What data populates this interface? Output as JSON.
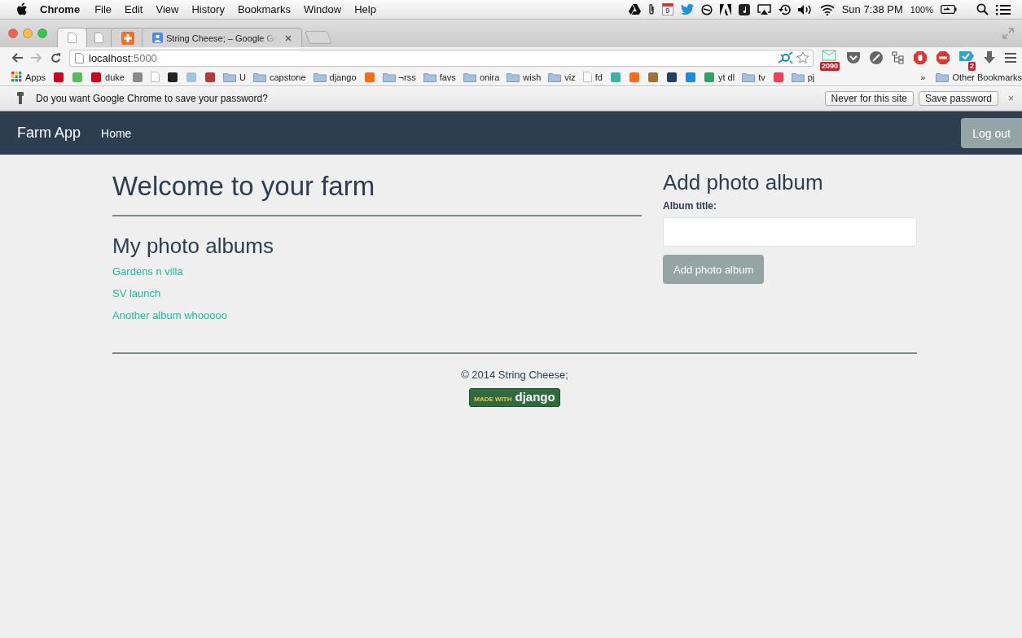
{
  "menubar": {
    "app": "Chrome",
    "menus": [
      "File",
      "Edit",
      "View",
      "History",
      "Bookmarks",
      "Window",
      "Help"
    ],
    "calendar_day": "9",
    "clock": "Sun 7:38 PM",
    "battery": "100%"
  },
  "tabs": [
    {
      "kind": "blank",
      "selected": true
    },
    {
      "kind": "blank",
      "selected": false
    },
    {
      "kind": "plus",
      "selected": false
    },
    {
      "kind": "site",
      "title": "String Cheese; – Google Gr",
      "selected": false
    }
  ],
  "toolbar": {
    "host": "localhost",
    "port": ":5000",
    "mail_badge": "2090",
    "task_badge": "2"
  },
  "bookmarks": [
    {
      "kind": "apps",
      "label": "Apps"
    },
    {
      "kind": "site",
      "color": "#d0021b"
    },
    {
      "kind": "site",
      "color": "#5cb85c"
    },
    {
      "kind": "site",
      "color": "#d0021b",
      "label": "duke"
    },
    {
      "kind": "site",
      "color": "#8a8a8a"
    },
    {
      "kind": "page"
    },
    {
      "kind": "site",
      "color": "#222222"
    },
    {
      "kind": "site",
      "color": "#9ec4e0"
    },
    {
      "kind": "site",
      "color": "#b23a3a"
    },
    {
      "kind": "folder",
      "label": "U"
    },
    {
      "kind": "folder",
      "label": "capstone"
    },
    {
      "kind": "folder",
      "label": "django"
    },
    {
      "kind": "site",
      "color": "#ff6a13"
    },
    {
      "kind": "folder",
      "label": "¬rss"
    },
    {
      "kind": "folder",
      "label": "favs"
    },
    {
      "kind": "folder",
      "label": "onira"
    },
    {
      "kind": "folder",
      "label": "wish"
    },
    {
      "kind": "folder",
      "label": "viz"
    },
    {
      "kind": "page",
      "label": "fd"
    },
    {
      "kind": "site",
      "color": "#3bb3a0"
    },
    {
      "kind": "site",
      "color": "#ff6a13"
    },
    {
      "kind": "site",
      "color": "#a0703a"
    },
    {
      "kind": "site",
      "color": "#1f3f6a"
    },
    {
      "kind": "site",
      "color": "#1e88e5"
    },
    {
      "kind": "site",
      "color": "#2fa06a",
      "label": "yt dl"
    },
    {
      "kind": "folder",
      "label": "tv"
    },
    {
      "kind": "site",
      "color": "#ee4056"
    },
    {
      "kind": "folder",
      "label": "pj"
    },
    {
      "kind": "overflow",
      "label": "»"
    },
    {
      "kind": "folder",
      "label": "Other Bookmarks"
    }
  ],
  "infobar": {
    "message": "Do you want Google Chrome to save your password?",
    "buttons": [
      "Never for this site",
      "Save password"
    ],
    "close": "×"
  },
  "navbar": {
    "brand": "Farm App",
    "links": [
      {
        "label": "Home"
      }
    ],
    "logout": "Log out"
  },
  "main": {
    "title": "Welcome to your farm",
    "albums_heading": "My photo albums",
    "albums": [
      "Gardens n villa",
      "SV launch",
      "Another album whooooo"
    ]
  },
  "form": {
    "heading": "Add photo album",
    "label": "Album title:",
    "button": "Add photo album"
  },
  "footer": {
    "copyright": "© 2014 String Cheese;",
    "badge_small": "MADE WITH",
    "badge_big": "django"
  }
}
